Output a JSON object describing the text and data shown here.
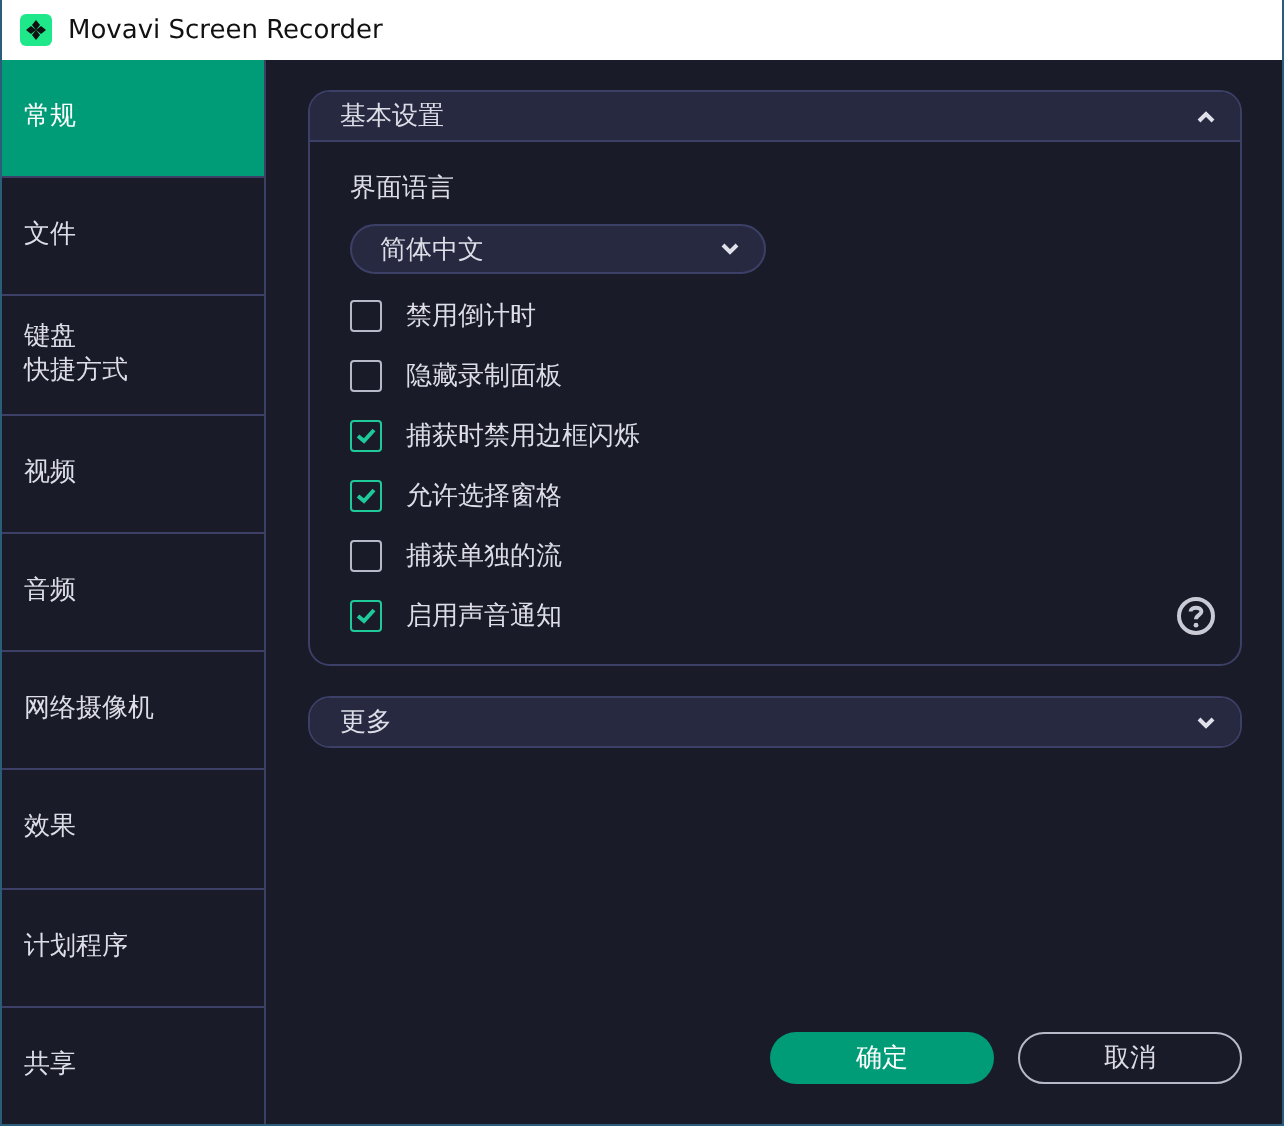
{
  "window": {
    "title": "Movavi Screen Recorder"
  },
  "sidebar": {
    "items": [
      {
        "lines": [
          "常规"
        ],
        "selected": true
      },
      {
        "lines": [
          "文件"
        ],
        "selected": false
      },
      {
        "lines": [
          "键盘",
          "快捷方式"
        ],
        "selected": false
      },
      {
        "lines": [
          "视频"
        ],
        "selected": false
      },
      {
        "lines": [
          "音频"
        ],
        "selected": false
      },
      {
        "lines": [
          "网络摄像机"
        ],
        "selected": false
      },
      {
        "lines": [
          "效果"
        ],
        "selected": false
      },
      {
        "lines": [
          "计划程序"
        ],
        "selected": false
      },
      {
        "lines": [
          "共享"
        ],
        "selected": false
      }
    ]
  },
  "sections": [
    {
      "title": "基本设置",
      "expanded": true,
      "language_label": "界面语言",
      "language_dropdown": {
        "value": "简体中文"
      },
      "options": [
        {
          "label": "禁用倒计时",
          "checked": false
        },
        {
          "label": "隐藏录制面板",
          "checked": false
        },
        {
          "label": "捕获时禁用边框闪烁",
          "checked": true
        },
        {
          "label": "允许选择窗格",
          "checked": true
        },
        {
          "label": "捕获单独的流",
          "checked": false
        },
        {
          "label": "启用声音通知",
          "checked": true
        }
      ]
    },
    {
      "title": "更多",
      "expanded": false
    }
  ],
  "buttons": [
    {
      "label": "确定",
      "kind": "primary"
    },
    {
      "label": "取消",
      "kind": "secondary"
    }
  ]
}
